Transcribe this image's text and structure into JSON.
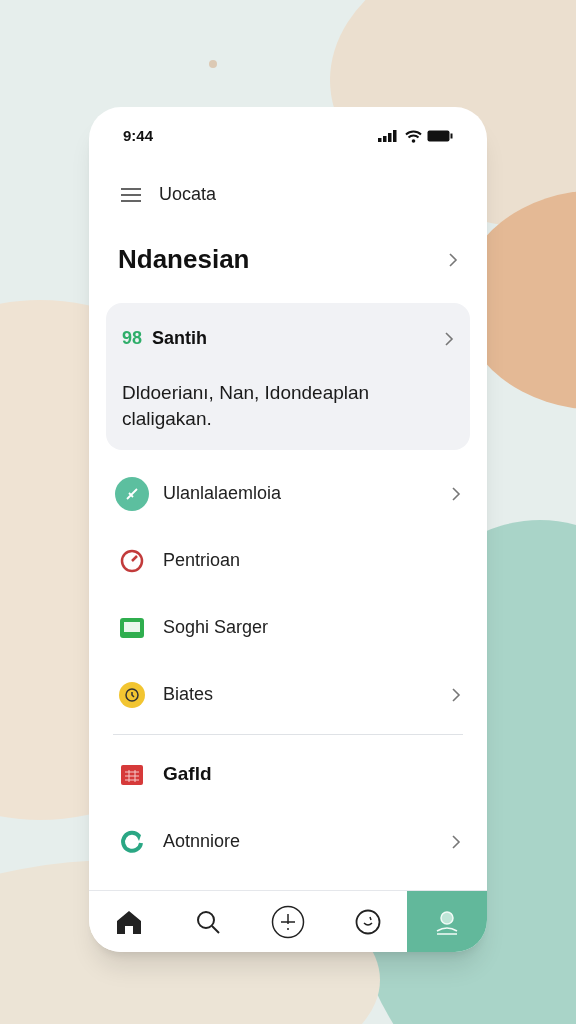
{
  "status_bar": {
    "time": "9:44"
  },
  "header": {
    "title": "Uocata"
  },
  "section": {
    "title": "Ndanesian",
    "chevron": true
  },
  "card": {
    "badge": "98",
    "title": "Santih",
    "chevron": true,
    "description": "Dldoerianı, Nan, Idondeaplan claligakan."
  },
  "lists": [
    [
      {
        "kind": "pen",
        "label": "Ulanlalaemloia",
        "chevron": true,
        "bold": false
      },
      {
        "kind": "gauge",
        "label": "Pentrioan",
        "chevron": false,
        "bold": false
      },
      {
        "kind": "screen",
        "label": "Soghi Sarger",
        "chevron": false,
        "bold": false
      },
      {
        "kind": "clock",
        "label": "Biates",
        "chevron": true,
        "bold": false
      }
    ],
    [
      {
        "kind": "calendar",
        "label": "Gafld",
        "chevron": false,
        "bold": true
      },
      {
        "kind": "refresh",
        "label": "Aotnniore",
        "chevron": true,
        "bold": false
      }
    ]
  ],
  "tab_bar": [
    {
      "kind": "home",
      "selected": false
    },
    {
      "kind": "search",
      "selected": false
    },
    {
      "kind": "add",
      "selected": false
    },
    {
      "kind": "face",
      "selected": false
    },
    {
      "kind": "profile",
      "selected": true
    }
  ]
}
